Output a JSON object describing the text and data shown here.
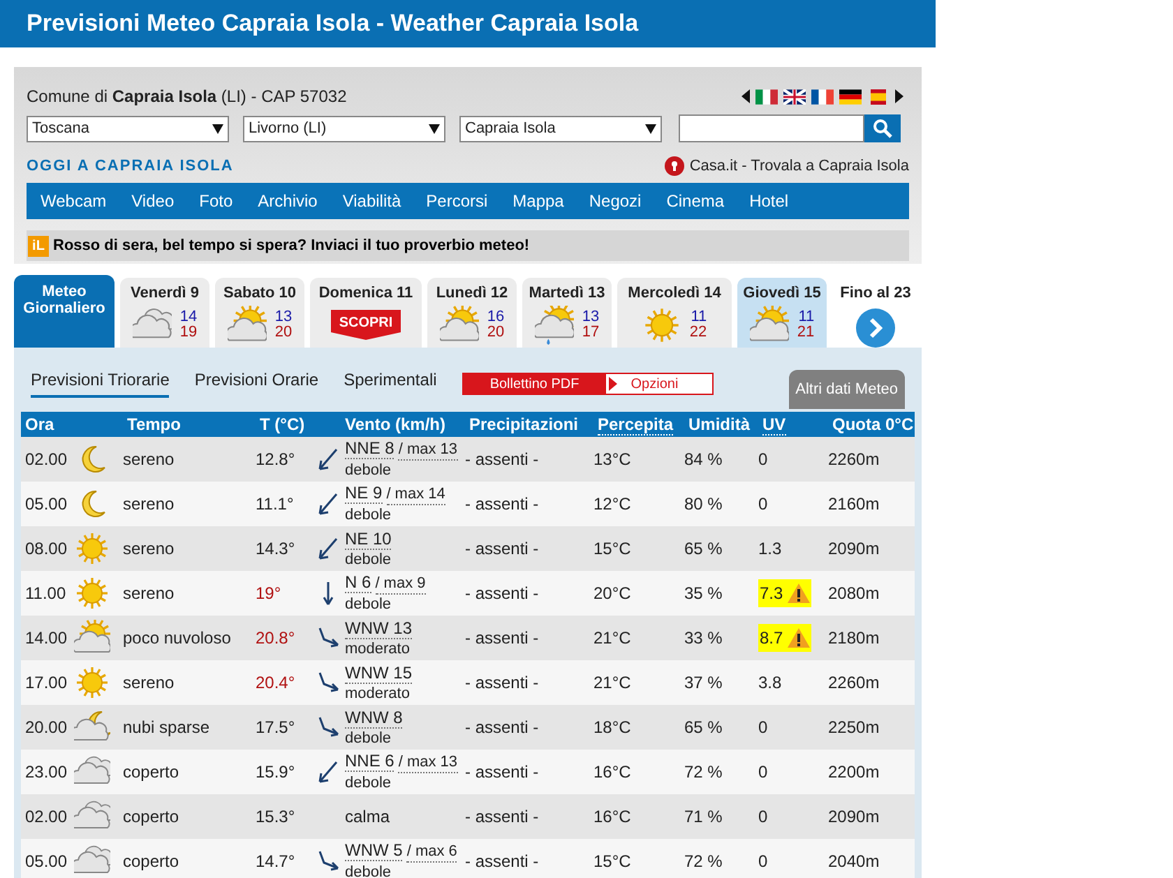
{
  "title": "Previsioni Meteo Capraia Isola - Weather Capraia Isola",
  "location": {
    "text": "Comune di **Capraia Isola** (LI) - CAP 57032"
  },
  "selects": [
    "Toscana",
    "Livorno (LI)",
    "Capraia Isola"
  ],
  "today_link": "OGGI A CAPRAIA ISOLA",
  "casa_link": "Casa.it - Trovala a Capraia Isola",
  "nav": [
    "Webcam",
    "Video",
    "Foto",
    "Archivio",
    "Viabilità",
    "Percorsi",
    "Mappa",
    "Negozi",
    "Cinema",
    "Hotel"
  ],
  "proverb": {
    "badge": "iL",
    "text": "Rosso di sera, bel tempo si spera? Inviaci il tuo proverbio meteo!"
  },
  "day_tabs": [
    {
      "kind": "daily",
      "label": "Meteo Giornaliero",
      "selected": true
    },
    {
      "kind": "cloud",
      "label": "Venerdì 9",
      "min": "14",
      "max": "19",
      "selected": false
    },
    {
      "kind": "sun-cloud",
      "label": "Sabato 10",
      "min": "13",
      "max": "20",
      "selected": false
    },
    {
      "kind": "promo",
      "label": "Domenica 11",
      "badge": "SCOPRI",
      "selected": false
    },
    {
      "kind": "sun-cloud",
      "label": "Lunedì 12",
      "min": "16",
      "max": "20",
      "selected": false
    },
    {
      "kind": "rain",
      "label": "Martedì 13",
      "min": "13",
      "max": "17",
      "selected": false
    },
    {
      "kind": "sun",
      "label": "Mercoledì 14",
      "min": "11",
      "max": "22",
      "selected": false
    },
    {
      "kind": "sun-cloud",
      "label": "Giovedì 15",
      "min": "11",
      "max": "21",
      "selected": true
    },
    {
      "kind": "more",
      "label": "Fino al 23",
      "selected": false
    }
  ],
  "sub_tabs": [
    {
      "label": "Previsioni Triorarie",
      "selected": true
    },
    {
      "label": "Previsioni Orarie",
      "selected": false
    },
    {
      "label": "Sperimentali",
      "selected": false
    }
  ],
  "pdf_button": "Bollettino PDF",
  "options_button": "Opzioni",
  "other_tab": "Altri dati Meteo",
  "table": {
    "columns": [
      "Ora",
      "Tempo",
      "T (°C)",
      "Vento (km/h)",
      "Precipitazioni",
      "Percepita",
      "Umidità",
      "UV",
      "Quota 0°C"
    ],
    "rows": [
      {
        "time": "02.00",
        "kind": "moon",
        "sky": "sereno",
        "temp": "12.8°",
        "hot": false,
        "wind": {
          "kind": "sw",
          "speed": "NNE 8",
          "gust": "/ max 13",
          "strength": "debole"
        },
        "rain": "- assenti -",
        "feels": "13°C",
        "humidity": "84 %",
        "uv": "0",
        "warning": false,
        "freezing": "2260m"
      },
      {
        "time": "05.00",
        "kind": "moon",
        "sky": "sereno",
        "temp": "11.1°",
        "hot": false,
        "wind": {
          "kind": "sw",
          "speed": "NE 9",
          "gust": "/ max 14",
          "strength": "debole"
        },
        "rain": "- assenti -",
        "feels": "12°C",
        "humidity": "80 %",
        "uv": "0",
        "warning": false,
        "freezing": "2160m"
      },
      {
        "time": "08.00",
        "kind": "sun",
        "sky": "sereno",
        "temp": "14.3°",
        "hot": false,
        "wind": {
          "kind": "sw",
          "speed": "NE 10",
          "strength": "debole"
        },
        "rain": "- assenti -",
        "feels": "15°C",
        "humidity": "65 %",
        "uv": "1.3",
        "warning": false,
        "freezing": "2090m"
      },
      {
        "time": "11.00",
        "kind": "sun",
        "sky": "sereno",
        "temp": "19°",
        "hot": true,
        "wind": {
          "kind": "s",
          "speed": "N 6",
          "gust": "/ max 9",
          "strength": "debole"
        },
        "rain": "- assenti -",
        "feels": "20°C",
        "humidity": "35 %",
        "uv": "7.3",
        "warning": true,
        "freezing": "2080m"
      },
      {
        "time": "14.00",
        "kind": "sun-cloud",
        "sky": "poco nuvoloso",
        "temp": "20.8°",
        "hot": true,
        "wind": {
          "kind": "se",
          "speed": "WNW 13",
          "strength": "moderato"
        },
        "rain": "- assenti -",
        "feels": "21°C",
        "humidity": "33 %",
        "uv": "8.7",
        "warning": true,
        "freezing": "2180m"
      },
      {
        "time": "17.00",
        "kind": "sun",
        "sky": "sereno",
        "temp": "20.4°",
        "hot": true,
        "wind": {
          "kind": "se",
          "speed": "WNW 15",
          "strength": "moderato"
        },
        "rain": "- assenti -",
        "feels": "21°C",
        "humidity": "37 %",
        "uv": "3.8",
        "warning": false,
        "freezing": "2260m"
      },
      {
        "time": "20.00",
        "kind": "moon-cloud",
        "sky": "nubi sparse",
        "temp": "17.5°",
        "hot": false,
        "wind": {
          "kind": "se",
          "speed": "WNW 8",
          "strength": "debole"
        },
        "rain": "- assenti -",
        "feels": "18°C",
        "humidity": "65 %",
        "uv": "0",
        "warning": false,
        "freezing": "2250m"
      },
      {
        "time": "23.00",
        "kind": "cloud",
        "sky": "coperto",
        "temp": "15.9°",
        "hot": false,
        "wind": {
          "kind": "sw",
          "speed": "NNE 6",
          "gust": "/ max 13",
          "strength": "debole"
        },
        "rain": "- assenti -",
        "feels": "16°C",
        "humidity": "72 %",
        "uv": "0",
        "warning": false,
        "freezing": "2200m"
      },
      {
        "time": "02.00",
        "kind": "cloud",
        "sky": "coperto",
        "temp": "15.3°",
        "hot": false,
        "wind": {
          "kind": "calm",
          "speed": "calma"
        },
        "rain": "- assenti -",
        "feels": "16°C",
        "humidity": "71 %",
        "uv": "0",
        "warning": false,
        "freezing": "2090m"
      },
      {
        "time": "05.00",
        "kind": "cloud",
        "sky": "coperto",
        "temp": "14.7°",
        "hot": false,
        "wind": {
          "kind": "se",
          "speed": "WNW 5",
          "gust": "/ max 6",
          "strength": "debole"
        },
        "rain": "- assenti -",
        "feels": "15°C",
        "humidity": "72 %",
        "uv": "0",
        "warning": false,
        "freezing": "2040m"
      }
    ]
  }
}
